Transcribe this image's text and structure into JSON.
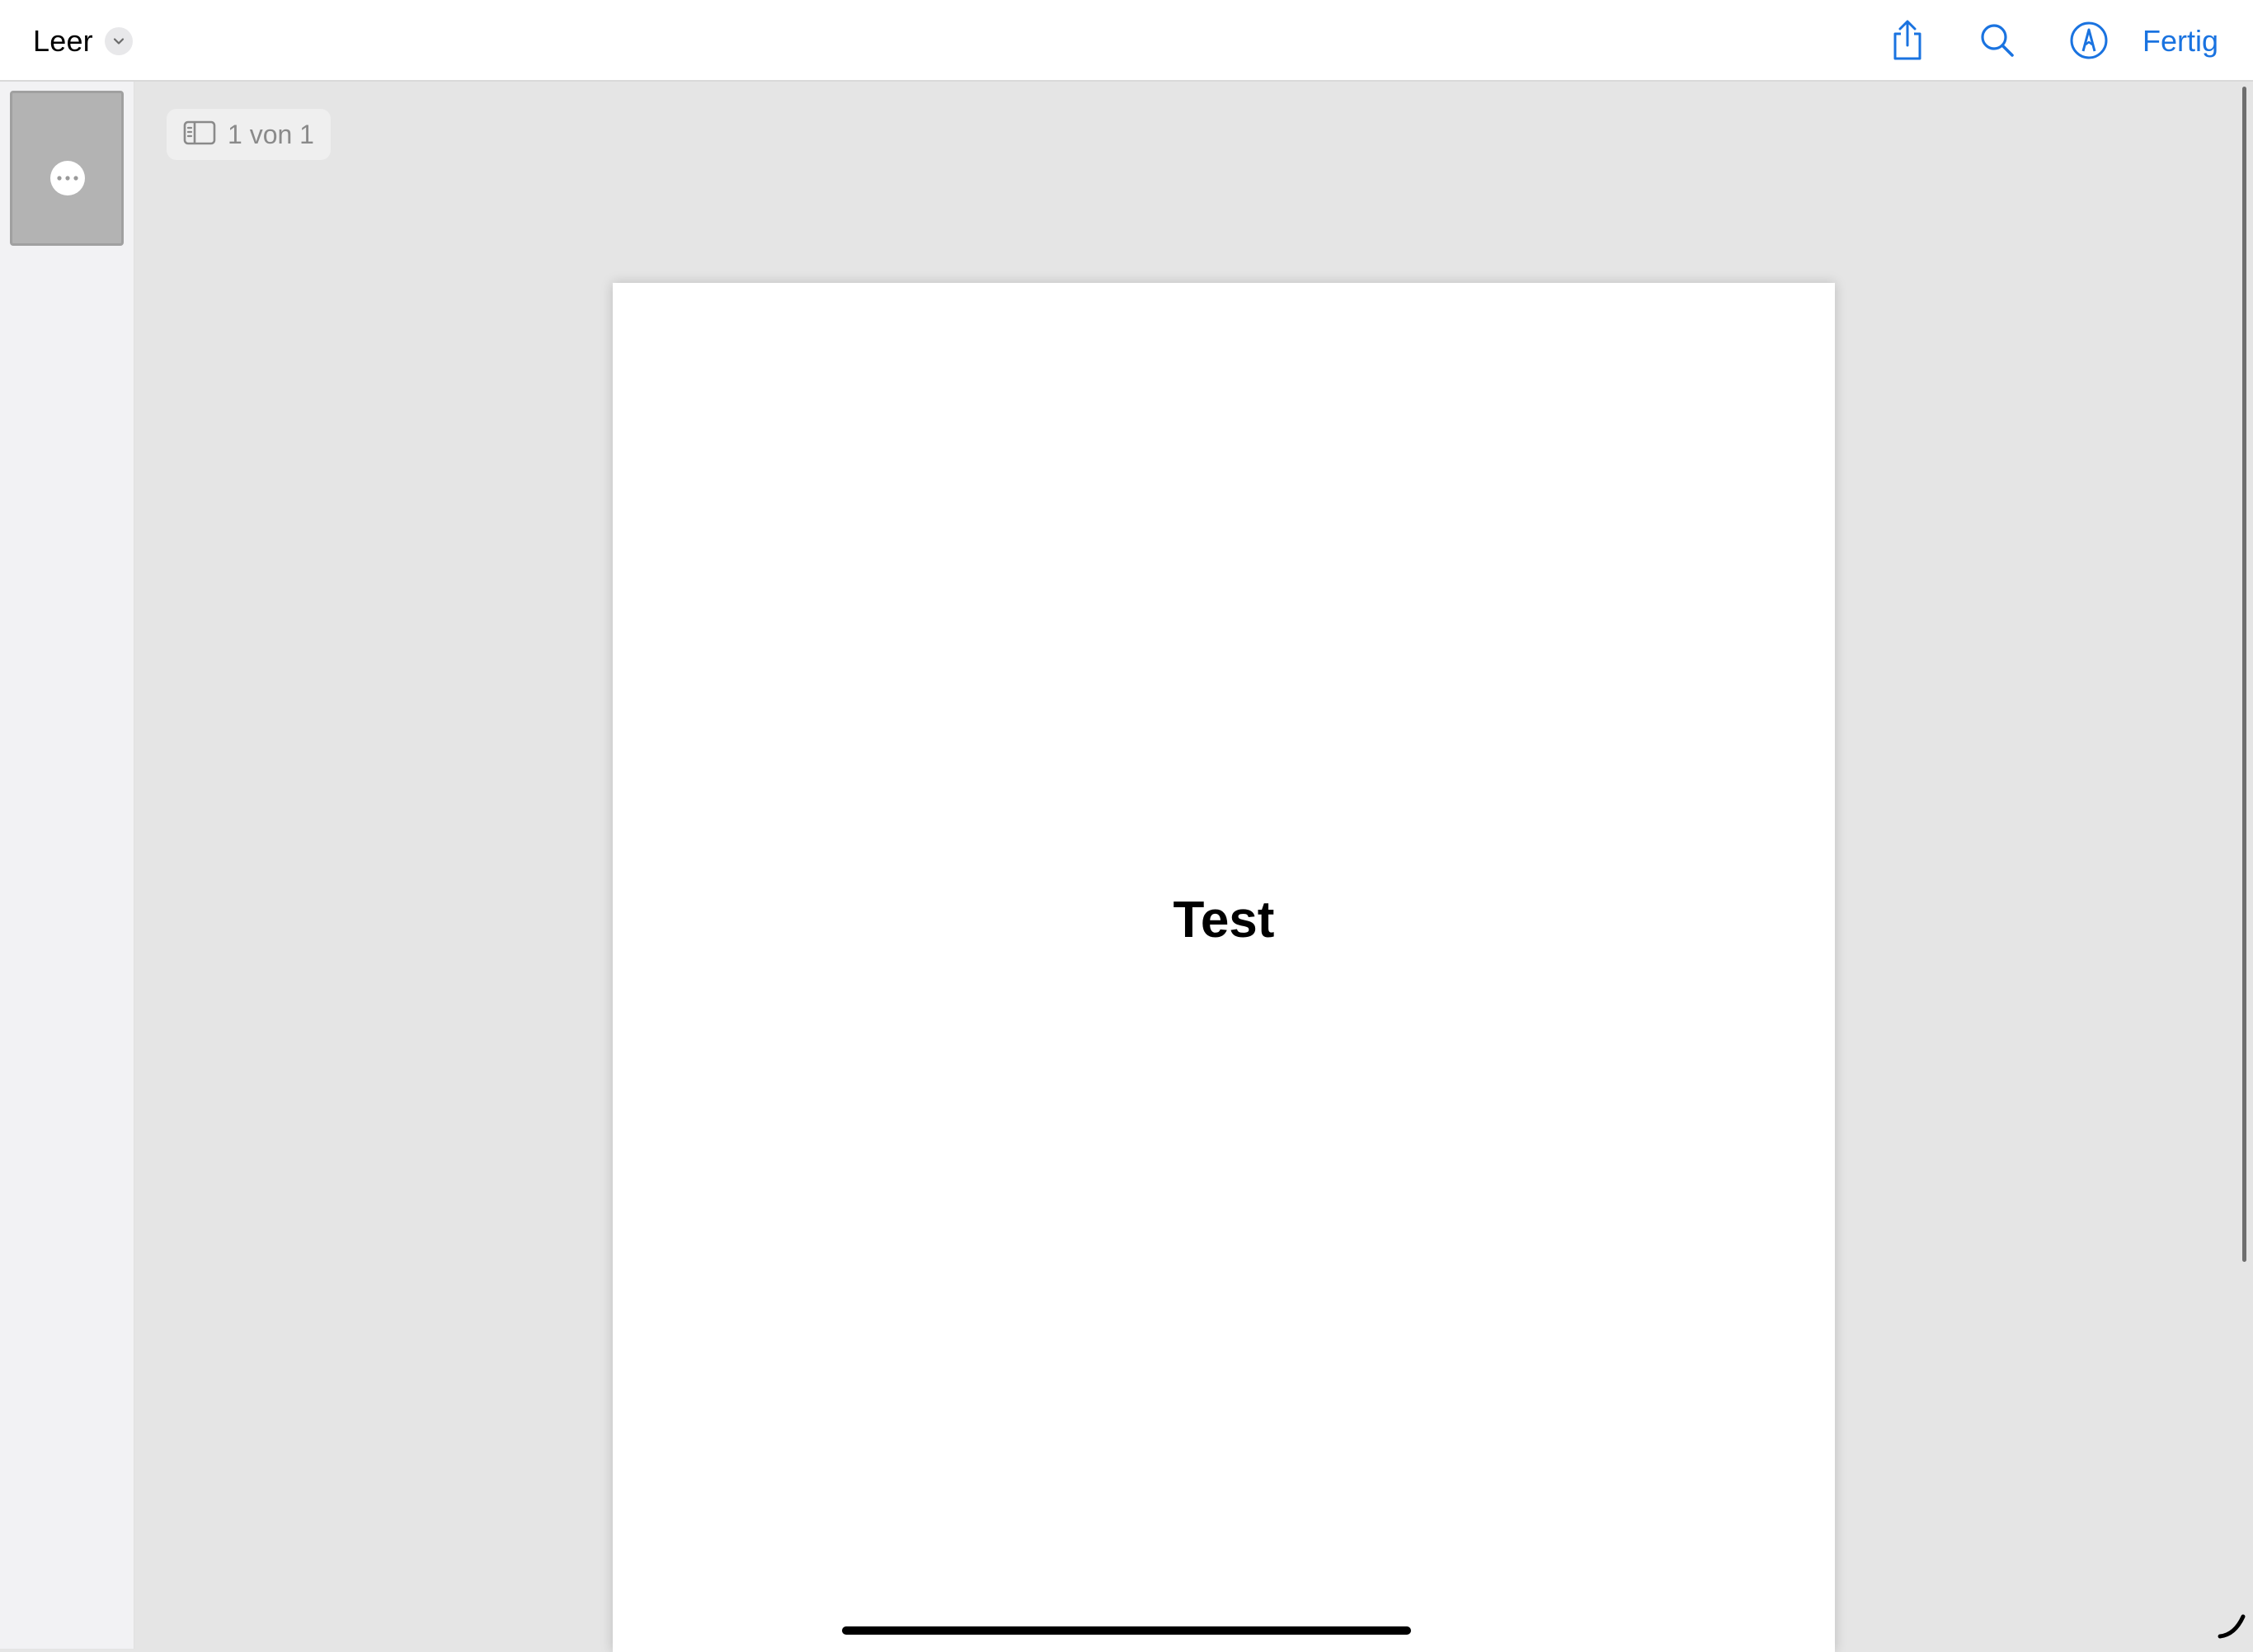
{
  "toolbar": {
    "title": "Leer",
    "icons": {
      "title_menu": "chevron-down-icon",
      "share": "share-icon",
      "search": "search-icon",
      "markup": "markup-pen-icon"
    },
    "done_label": "Fertig",
    "accent_color": "#1a73e0"
  },
  "sidebar": {
    "thumbnail_menu_icon": "ellipsis-icon"
  },
  "page_indicator": {
    "icon": "sidebar-icon",
    "label": "1 von 1"
  },
  "document": {
    "text": "Test"
  }
}
